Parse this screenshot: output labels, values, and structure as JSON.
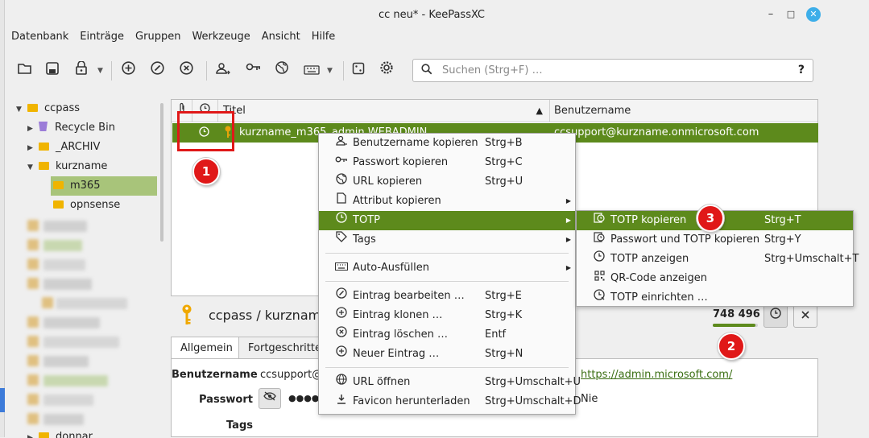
{
  "window": {
    "title": "cc neu* - KeePassXC",
    "minimize": "–",
    "maximize": "□",
    "close": "✕"
  },
  "menubar": [
    "Datenbank",
    "Einträge",
    "Gruppen",
    "Werkzeuge",
    "Ansicht",
    "Hilfe"
  ],
  "toolbar": {
    "icons": [
      "open-database-icon",
      "save-database-icon",
      "lock-database-icon",
      "add-entry-icon",
      "edit-entry-icon",
      "delete-entry-icon",
      "copy-username-icon",
      "copy-password-icon",
      "copy-url-icon",
      "auto-type-icon",
      "password-generator-icon",
      "settings-icon"
    ]
  },
  "search": {
    "placeholder": "Suchen (Strg+F) …",
    "help": "?"
  },
  "tree": {
    "root": "ccpass",
    "items": [
      "Recycle Bin",
      "_ARCHIV",
      "kurzname",
      "m365",
      "opnsense"
    ],
    "partial_bottom": "donnar"
  },
  "entries": {
    "columns": {
      "attach": "📎",
      "totp": "◷",
      "title": "Titel",
      "username": "Benutzername"
    },
    "rows": [
      {
        "title": "kurzname_m365_admin WEBADMIN",
        "username": "ccsupport@kurzname.onmicrosoft.com"
      }
    ]
  },
  "detail": {
    "path": "ccpass / kurzname /",
    "totp": "748 496",
    "totp_progress": 0.95,
    "tabs": [
      "Allgemein",
      "Fortgeschritten"
    ],
    "fields": {
      "username_label": "Benutzername",
      "username_value": "ccsupport@k",
      "password_label": "Passwort",
      "password_value": "●●●●●",
      "tags_label": "Tags",
      "url_value": "https://admin.microsoft.com/",
      "expiry_value": "Nie"
    }
  },
  "context_menu": {
    "items": [
      {
        "label": "Benutzername kopieren",
        "shortcut": "Strg+B",
        "icon": "copy-username-icon"
      },
      {
        "label": "Passwort kopieren",
        "shortcut": "Strg+C",
        "icon": "copy-password-icon"
      },
      {
        "label": "URL kopieren",
        "shortcut": "Strg+U",
        "icon": "copy-url-icon"
      },
      {
        "label": "Attribut kopieren",
        "shortcut": "",
        "icon": "copy-attribute-icon"
      },
      {
        "label": "TOTP",
        "shortcut": "",
        "icon": "clock-icon"
      },
      {
        "label": "Tags",
        "shortcut": "",
        "icon": "tag-icon"
      },
      {
        "label": "Auto-Ausfüllen",
        "shortcut": "",
        "icon": "keyboard-icon"
      },
      {
        "label": "Eintrag bearbeiten …",
        "shortcut": "Strg+E",
        "icon": "edit-icon"
      },
      {
        "label": "Eintrag klonen …",
        "shortcut": "Strg+K",
        "icon": "clone-icon"
      },
      {
        "label": "Eintrag löschen …",
        "shortcut": "Entf",
        "icon": "delete-icon"
      },
      {
        "label": "Neuer Eintrag …",
        "shortcut": "Strg+N",
        "icon": "add-icon"
      },
      {
        "label": "URL öffnen",
        "shortcut": "Strg+Umschalt+U",
        "icon": "globe-icon"
      },
      {
        "label": "Favicon herunterladen",
        "shortcut": "Strg+Umschalt+D",
        "icon": "download-icon"
      }
    ]
  },
  "totp_submenu": {
    "items": [
      {
        "label": "TOTP kopieren",
        "shortcut": "Strg+T",
        "icon": "copy-totp-icon"
      },
      {
        "label": "Passwort und TOTP kopieren",
        "shortcut": "Strg+Y",
        "icon": "copy-password-totp-icon"
      },
      {
        "label": "TOTP anzeigen",
        "shortcut": "Strg+Umschalt+T",
        "icon": "clock-icon"
      },
      {
        "label": "QR-Code anzeigen",
        "shortcut": "",
        "icon": "qr-code-icon"
      },
      {
        "label": "TOTP einrichten …",
        "shortcut": "",
        "icon": "setup-totp-icon"
      }
    ]
  },
  "annotations": [
    "1",
    "2",
    "3"
  ],
  "colors": {
    "accent": "#5d8a1c",
    "badge": "#e01818",
    "folder": "#f0b400"
  }
}
